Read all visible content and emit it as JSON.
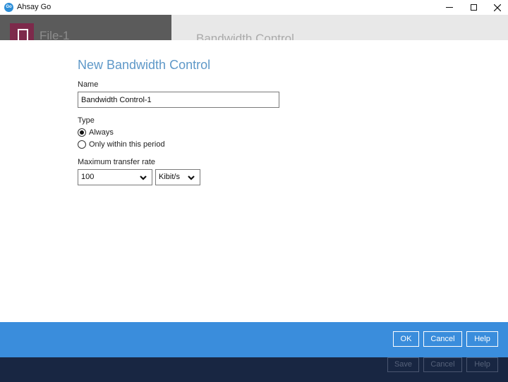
{
  "window": {
    "title": "Ahsay Go",
    "logo_text": "Go",
    "icons": [
      "minimize-icon",
      "maximize-icon",
      "close-icon"
    ]
  },
  "background": {
    "left_label": "File-1",
    "right_label": "Bandwidth Control",
    "footer_buttons": {
      "save": "Save",
      "cancel": "Cancel",
      "help": "Help"
    }
  },
  "dialog": {
    "title": "New Bandwidth Control",
    "name_label": "Name",
    "name_value": "Bandwidth Control-1",
    "type_label": "Type",
    "type_options": [
      {
        "label": "Always",
        "checked": true
      },
      {
        "label": "Only within this period",
        "checked": false
      }
    ],
    "rate_label": "Maximum transfer rate",
    "rate_value": "100",
    "rate_unit": "Kibit/s"
  },
  "footer": {
    "ok": "OK",
    "cancel": "Cancel",
    "help": "Help"
  },
  "colors": {
    "accent": "#3a8ddc",
    "title_blue": "#5e98c8",
    "dark_footer": "#182642"
  }
}
